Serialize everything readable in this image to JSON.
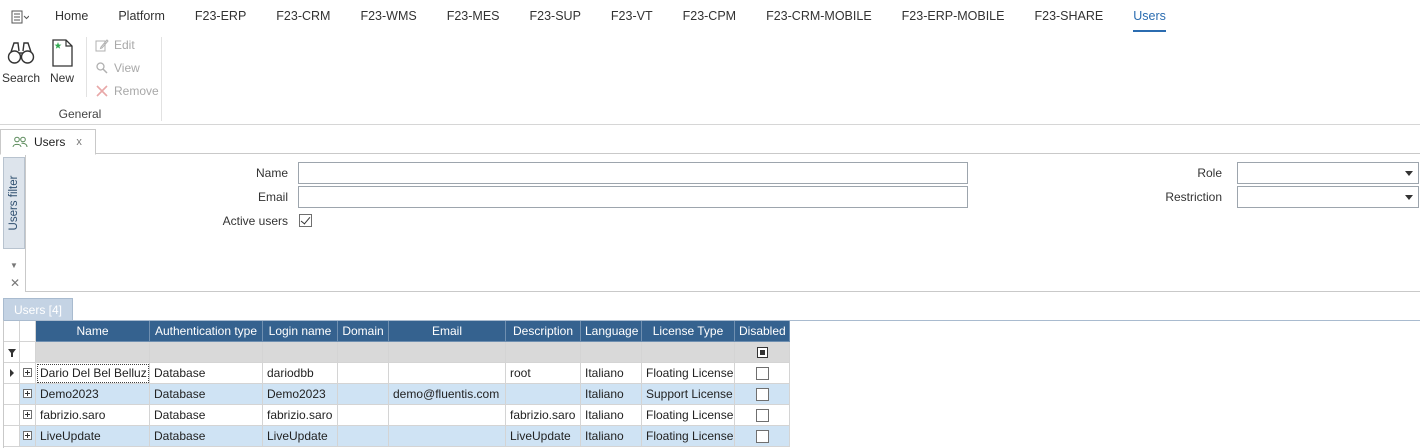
{
  "menubar": {
    "items": [
      {
        "label": "Home"
      },
      {
        "label": "Platform"
      },
      {
        "label": "F23-ERP"
      },
      {
        "label": "F23-CRM"
      },
      {
        "label": "F23-WMS"
      },
      {
        "label": "F23-MES"
      },
      {
        "label": "F23-SUP"
      },
      {
        "label": "F23-VT"
      },
      {
        "label": "F23-CPM"
      },
      {
        "label": "F23-CRM-MOBILE"
      },
      {
        "label": "F23-ERP-MOBILE"
      },
      {
        "label": "F23-SHARE"
      },
      {
        "label": "Users"
      }
    ],
    "active": "Users",
    "accent_color": "#2b6cb0"
  },
  "ribbon": {
    "search_label": "Search",
    "new_label": "New",
    "edit_label": "Edit",
    "view_label": "View",
    "remove_label": "Remove",
    "group_label": "General"
  },
  "doc_tab": {
    "label": "Users",
    "close": "x"
  },
  "filter": {
    "side_label": "Users filter",
    "name_label": "Name",
    "name_value": "",
    "email_label": "Email",
    "email_value": "",
    "active_users_label": "Active users",
    "active_users_checked": true,
    "role_label": "Role",
    "role_value": "",
    "restriction_label": "Restriction",
    "restriction_value": ""
  },
  "grid": {
    "tab_label": "Users [4]",
    "header_color": "#35628f",
    "alt_row_color": "#cfe3f4",
    "columns": [
      "Name",
      "Authentication type",
      "Login name",
      "Domain",
      "Email",
      "Description",
      "Language",
      "License Type",
      "Disabled"
    ],
    "rows": [
      {
        "name": "Dario Del Bel Belluz",
        "auth": "Database",
        "login": "dariodbb",
        "domain": "",
        "email": "",
        "description": "root",
        "language": "Italiano",
        "license": "Floating License",
        "disabled": false
      },
      {
        "name": "Demo2023",
        "auth": "Database",
        "login": "Demo2023",
        "domain": "",
        "email": "demo@fluentis.com",
        "description": "",
        "language": "Italiano",
        "license": "Support License",
        "disabled": false
      },
      {
        "name": "fabrizio.saro",
        "auth": "Database",
        "login": "fabrizio.saro",
        "domain": "",
        "email": "",
        "description": "fabrizio.saro",
        "language": "Italiano",
        "license": "Floating License",
        "disabled": false
      },
      {
        "name": "LiveUpdate",
        "auth": "Database",
        "login": "LiveUpdate",
        "domain": "",
        "email": "",
        "description": "LiveUpdate",
        "language": "Italiano",
        "license": "Floating License",
        "disabled": false
      }
    ]
  }
}
